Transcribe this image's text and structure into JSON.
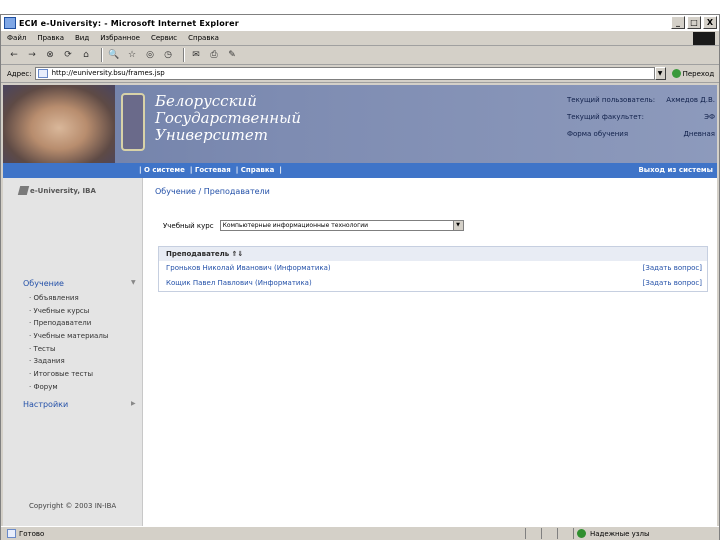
{
  "window": {
    "title": "ЕСИ e-University: - Microsoft Internet Explorer",
    "minimize": "_",
    "maximize": "□",
    "close": "X"
  },
  "menu": [
    "Файл",
    "Правка",
    "Вид",
    "Избранное",
    "Сервис",
    "Справка"
  ],
  "toolbar": {
    "back": "←",
    "forward": "→",
    "stop": "⊗",
    "refresh": "⟳",
    "home": "⌂",
    "search": "🔍",
    "favorites": "☆",
    "media": "◎",
    "history": "◷",
    "mail": "✉",
    "print": "⎙",
    "edit": "✎"
  },
  "address": {
    "label": "Адрес:",
    "url": "http://euniversity.bsu/frames.jsp",
    "go": "Переход"
  },
  "banner": {
    "university_name": [
      "Белорусский",
      "Государственный",
      "Университет"
    ],
    "info": [
      {
        "key": "Текущий пользователь:",
        "value": "Ахмедов Д.В."
      },
      {
        "key": "Текущий факультет:",
        "value": "ЭФ"
      },
      {
        "key": "Форма обучения",
        "value": "Дневная"
      }
    ]
  },
  "navbar": {
    "links": [
      "| О системе",
      "| Гостевая",
      "| Справка",
      "|"
    ],
    "logout": "Выход из системы"
  },
  "sidebar": {
    "brand": "e-University, IBA",
    "sections": {
      "learning": "Обучение",
      "settings": "Настройки"
    },
    "items": [
      "Объявления",
      "Учебные курсы",
      "Преподаватели",
      "Учебные материалы",
      "Тесты",
      "Задания",
      "Итоговые тесты",
      "Форум"
    ],
    "copyright": "Copyright © 2003 IN-IBA"
  },
  "content": {
    "heading": "Обучение / Преподаватели",
    "course_label": "Учебный курс",
    "course_value": "Компьютерные информационные технологии",
    "table_header": "Преподаватель ⇑⇓",
    "tutors": [
      {
        "name": "Гроньков Николай Иванович (Информатика)",
        "action": "[Задать вопрос]"
      },
      {
        "name": "Кощик Павел Павлович (Информатика)",
        "action": "[Задать вопрос]"
      }
    ]
  },
  "status": {
    "text": "Готово",
    "zone": "Надежные узлы"
  }
}
